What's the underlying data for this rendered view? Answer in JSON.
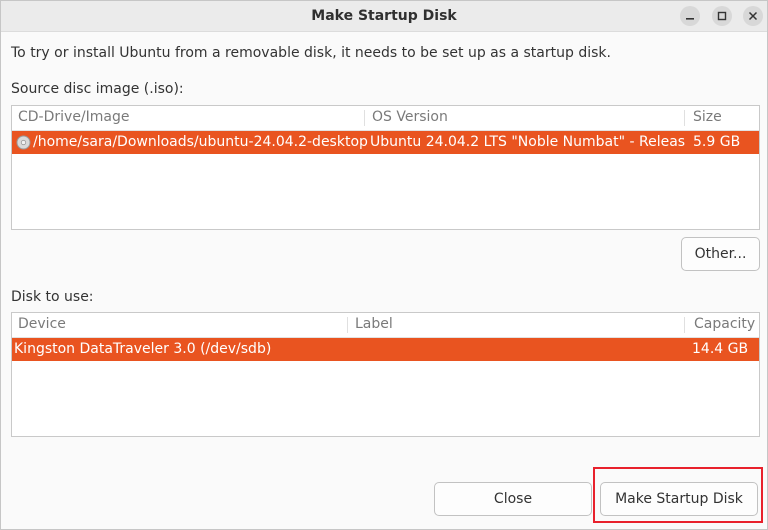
{
  "window": {
    "title": "Make Startup Disk"
  },
  "intro_text": "To try or install Ubuntu from a removable disk, it needs to be set up as a startup disk.",
  "source_section": {
    "label": "Source disc image (.iso):",
    "columns": [
      "CD-Drive/Image",
      "OS Version",
      "Size"
    ],
    "rows": [
      {
        "icon": "disc-icon",
        "image": "/home/sara/Downloads/ubuntu-24.04.2-desktop-...",
        "os_version": "Ubuntu 24.04.2 LTS \"Noble Numbat\" - Release ...",
        "size": "5.9 GB",
        "selected": true
      }
    ],
    "other_button": "Other..."
  },
  "disk_section": {
    "label": "Disk to use:",
    "columns": [
      "Device",
      "Label",
      "Capacity"
    ],
    "rows": [
      {
        "device": "Kingston DataTraveler 3.0 (/dev/sdb)",
        "label": "",
        "capacity": "14.4 GB",
        "selected": true
      }
    ]
  },
  "buttons": {
    "close": "Close",
    "make": "Make Startup Disk"
  },
  "colors": {
    "selection": "#e95420",
    "highlight_box": "#e8212c"
  }
}
